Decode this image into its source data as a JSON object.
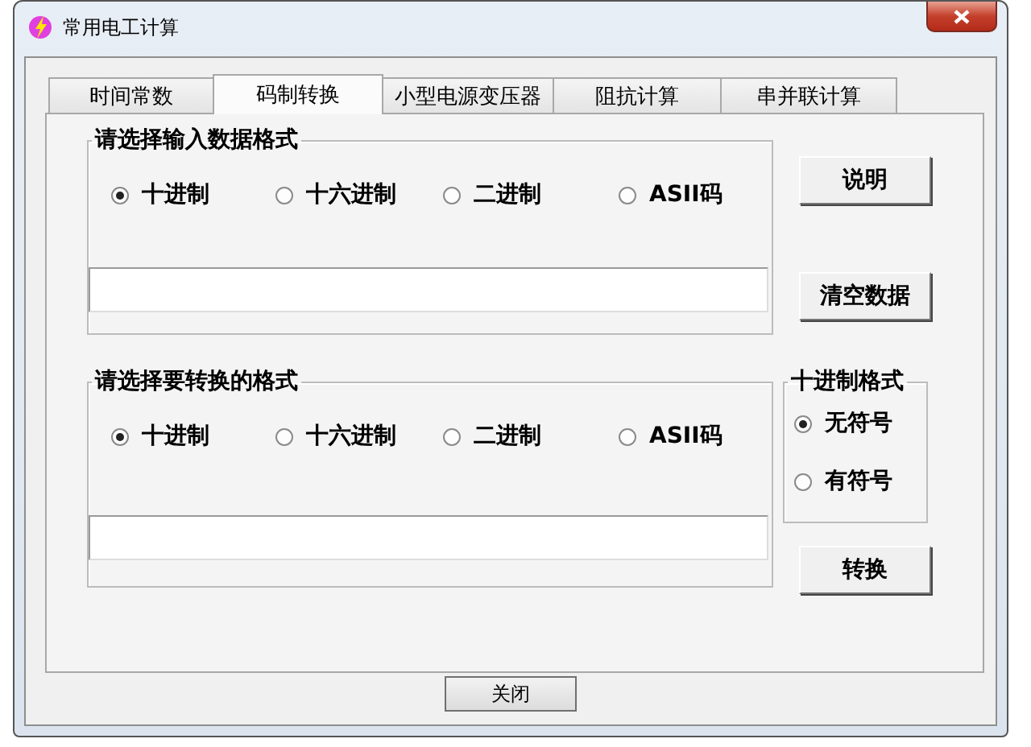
{
  "window": {
    "title": "常用电工计算"
  },
  "tabs": [
    {
      "label": "时间常数",
      "selected": false
    },
    {
      "label": "码制转换",
      "selected": true
    },
    {
      "label": "小型电源变压器",
      "selected": false
    },
    {
      "label": "阻抗计算",
      "selected": false
    },
    {
      "label": "串并联计算",
      "selected": false
    }
  ],
  "input_group": {
    "legend": "请选择输入数据格式",
    "options": [
      {
        "label": "十进制",
        "selected": true
      },
      {
        "label": "十六进制",
        "selected": false
      },
      {
        "label": "二进制",
        "selected": false
      },
      {
        "label": "ASII码",
        "selected": false
      }
    ]
  },
  "help_button": "说明",
  "clear_button": "清空数据",
  "output_group": {
    "legend": "请选择要转换的格式",
    "options": [
      {
        "label": "十进制",
        "selected": true
      },
      {
        "label": "十六进制",
        "selected": false
      },
      {
        "label": "二进制",
        "selected": false
      },
      {
        "label": "ASII码",
        "selected": false
      }
    ]
  },
  "decimal_format": {
    "legend": "十进制格式",
    "options": [
      {
        "label": "无符号",
        "selected": true
      },
      {
        "label": "有符号",
        "selected": false
      }
    ]
  },
  "convert_button": "转换",
  "close_button": "关闭"
}
